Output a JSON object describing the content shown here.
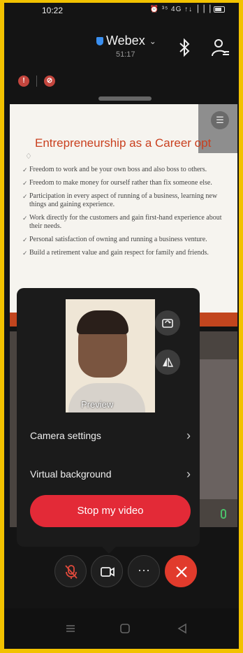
{
  "status_bar": {
    "time": "10:22",
    "indicators": "⏰ ³⁵ 4G ↑↓▕▕▕"
  },
  "header": {
    "app_name": "Webex",
    "elapsed": "51:17"
  },
  "badges": [
    "!",
    "⊘"
  ],
  "slide": {
    "title": "Entrepreneurship as a Career opt",
    "bullets": [
      "Freedom to work and be your own boss and also boss to others.",
      "Freedom to make money for ourself rather than fix someone else.",
      "Participation in every aspect of running of a business, learning new things and gaining experience.",
      "Work directly for the customers and gain first-hand experience about their needs.",
      "Personal satisfaction of owning and running a business venture.",
      "Build a retirement value and gain respect for family and friends."
    ]
  },
  "popup": {
    "preview_label": "Preview",
    "camera_settings_label": "Camera settings",
    "virtual_background_label": "Virtual background",
    "stop_video_label": "Stop my video"
  },
  "colors": {
    "accent_red": "#e32a37",
    "end_call": "#e13b2c",
    "slide_title": "#c9401f",
    "frame": "#f2c200"
  },
  "icons": [
    "shield-icon",
    "chevron-down-icon",
    "bluetooth-icon",
    "participants-icon",
    "camera-flip-icon",
    "mirror-icon",
    "chevron-right-icon",
    "mic-off-icon",
    "video-icon",
    "more-icon",
    "close-icon"
  ]
}
